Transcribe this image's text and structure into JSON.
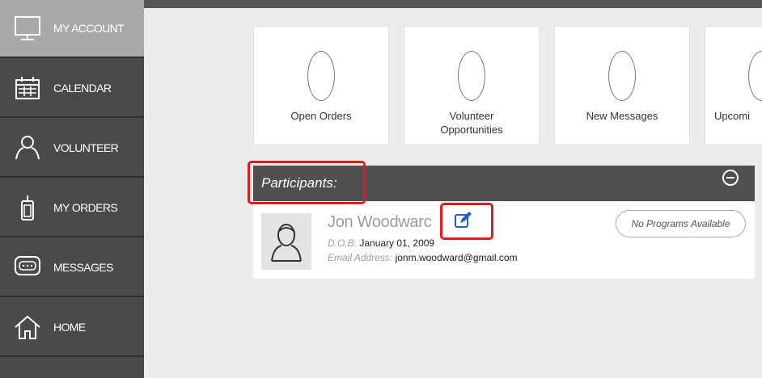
{
  "sidebar": {
    "items": [
      {
        "label": "MY ACCOUNT",
        "icon": "monitor-icon",
        "active": true
      },
      {
        "label": "CALENDAR",
        "icon": "calendar-icon"
      },
      {
        "label": "VOLUNTEER",
        "icon": "person-outline-icon"
      },
      {
        "label": "MY ORDERS",
        "icon": "phone-icon"
      },
      {
        "label": "MESSAGES",
        "icon": "chat-bubble-icon"
      },
      {
        "label": "HOME",
        "icon": "home-icon"
      }
    ]
  },
  "summary_cards": [
    {
      "count": "0",
      "label": "Open Orders"
    },
    {
      "count": "0",
      "label": "Volunteer\nOpportunities"
    },
    {
      "count": "0",
      "label": "New Messages"
    },
    {
      "count": "0",
      "label": "Upcomi"
    }
  ],
  "participants": {
    "title": "Participants:",
    "collapse_icon": "minus-circle-icon",
    "list": [
      {
        "name": "Jon Woodwarc",
        "dob_label": "D.O.B:",
        "dob": "January 01, 2009",
        "email_label": "Email Address:",
        "email": "jonm.woodward@gmail.com",
        "programs_status": "No Programs Available"
      }
    ]
  },
  "colors": {
    "sidebar": "#4a4a4a",
    "sidebar_active": "#a9a9a9",
    "header_bar": "#505050",
    "edit_icon": "#2b5eb5",
    "highlight": "#e31b1b"
  }
}
